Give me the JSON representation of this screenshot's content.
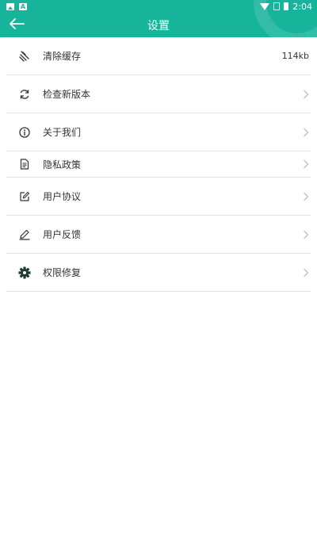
{
  "statusbar": {
    "time": "2:04",
    "left_icons": [
      "image-icon",
      "a-icon"
    ],
    "right_icons": [
      "wifi-icon",
      "no-sim-icon",
      "battery-icon"
    ]
  },
  "header": {
    "title": "设置",
    "back_icon": "arrow-left-icon",
    "background_color": "#17b39b"
  },
  "settings": {
    "items": [
      {
        "label": "清除缓存",
        "icon": "broom-icon",
        "value": "114kb"
      },
      {
        "label": "检查新版本",
        "icon": "refresh-icon"
      },
      {
        "label": "关于我们",
        "icon": "info-icon"
      },
      {
        "label": "隐私政策",
        "icon": "document-icon"
      },
      {
        "label": "用户协议",
        "icon": "edit-icon"
      },
      {
        "label": "用户反馈",
        "icon": "pen-icon"
      },
      {
        "label": "权限修复",
        "icon": "gear-icon"
      }
    ]
  }
}
